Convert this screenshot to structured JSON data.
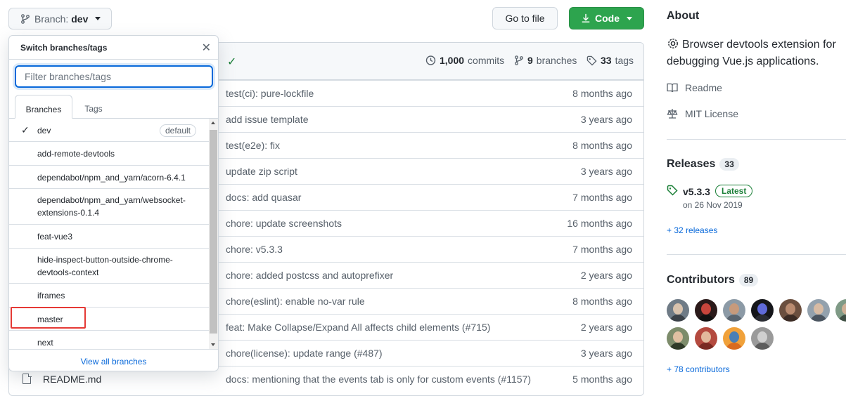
{
  "toolbar": {
    "branch_label": "Branch:",
    "branch_value": "dev",
    "goto_file": "Go to file",
    "code": "Code"
  },
  "repo_stats": {
    "commits_count": "1,000",
    "commits_label": "commits",
    "branches_count": "9",
    "branches_label": "branches",
    "tags_count": "33",
    "tags_label": "tags"
  },
  "commits": [
    {
      "message": "test(ci): pure-lockfile",
      "age": "8 months ago"
    },
    {
      "message": "add issue template",
      "age": "3 years ago"
    },
    {
      "message": "test(e2e): fix",
      "age": "8 months ago"
    },
    {
      "message": "update zip script",
      "age": "3 years ago"
    },
    {
      "message": "docs: add quasar",
      "age": "7 months ago"
    },
    {
      "message": "chore: update screenshots",
      "age": "16 months ago"
    },
    {
      "message": "chore: v5.3.3",
      "age": "7 months ago"
    },
    {
      "message": "chore: added postcss and autoprefixer",
      "age": "2 years ago"
    },
    {
      "message": "chore(eslint): enable no-var rule",
      "age": "8 months ago"
    },
    {
      "message": "feat: Make Collapse/Expand All affects child elements (#715)",
      "age": "2 years ago"
    },
    {
      "message": "chore(license): update range (#487)",
      "age": "3 years ago"
    },
    {
      "message": "docs: mentioning that the events tab is only for custom events (#1157)",
      "age": "5 months ago"
    }
  ],
  "readme_file": "README.md",
  "dropdown": {
    "title": "Switch branches/tags",
    "filter_placeholder": "Filter branches/tags",
    "tab_branches": "Branches",
    "tab_tags": "Tags",
    "default_badge": "default",
    "branches": [
      "dev",
      "add-remote-devtools",
      "dependabot/npm_and_yarn/acorn-6.4.1",
      "dependabot/npm_and_yarn/websocket-extensions-0.1.4",
      "feat-vue3",
      "hide-inspect-button-outside-chrome-devtools-context",
      "iframes",
      "master",
      "next"
    ],
    "view_all": "View all branches"
  },
  "about": {
    "heading": "About",
    "description": "Browser devtools extension for debugging Vue.js applications.",
    "readme": "Readme",
    "license": "MIT License"
  },
  "releases": {
    "heading": "Releases",
    "count": "33",
    "version": "v5.3.3",
    "latest_badge": "Latest",
    "date": "on 26 Nov 2019",
    "more_link": "+ 32 releases"
  },
  "contributors": {
    "heading": "Contributors",
    "count": "89",
    "more_link": "+ 78 contributors"
  },
  "colors": {
    "accent_blue": "#0969da",
    "code_green": "#2da44e",
    "highlight_red": "#e53935"
  }
}
